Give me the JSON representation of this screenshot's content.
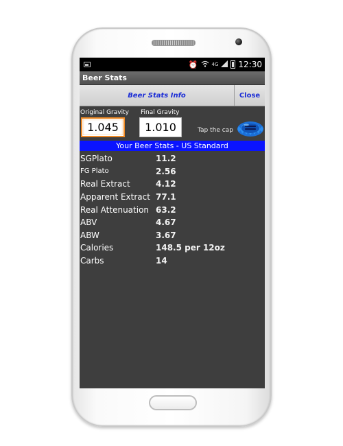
{
  "status_bar": {
    "time": "12:30",
    "network": "4G"
  },
  "app": {
    "title": "Beer Stats"
  },
  "toolbar": {
    "info_label": "Beer Stats Info",
    "close_label": "Close"
  },
  "inputs": {
    "original_gravity_label": "Original Gravity",
    "original_gravity_value": "1.045",
    "final_gravity_label": "Final Gravity",
    "final_gravity_value": "1.010",
    "tap_label": "Tap the cap",
    "cap_icon": "bottle-cap-icon"
  },
  "stats_header": "Your Beer Stats - US Standard",
  "stats": [
    {
      "label": "SGPlato",
      "value": "11.2"
    },
    {
      "label": "FG Plato",
      "value": "2.56"
    },
    {
      "label": "Real Extract",
      "value": "4.12"
    },
    {
      "label": "Apparent Extract",
      "value": "77.1"
    },
    {
      "label": "Real Attenuation",
      "value": "63.2"
    },
    {
      "label": "ABV",
      "value": "4.67"
    },
    {
      "label": "ABW",
      "value": "3.67"
    },
    {
      "label": "Calories",
      "value": "148.5 per 12oz"
    },
    {
      "label": "Carbs",
      "value": "14"
    }
  ],
  "colors": {
    "accent_blue": "#0a14ff",
    "link_blue": "#1a2cd6",
    "focus_orange": "#f08a24",
    "screen_bg": "#3e3e3e"
  }
}
